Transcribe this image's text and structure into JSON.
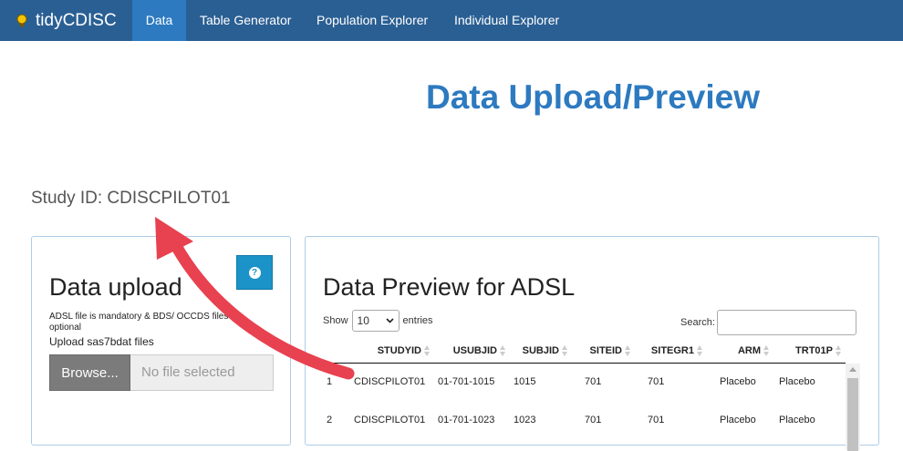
{
  "navbar": {
    "brand": "tidyCDISC",
    "tabs": [
      {
        "label": "Data",
        "active": true
      },
      {
        "label": "Table Generator",
        "active": false
      },
      {
        "label": "Population Explorer",
        "active": false
      },
      {
        "label": "Individual Explorer",
        "active": false
      }
    ]
  },
  "page": {
    "title": "Data Upload/Preview",
    "study_id": "Study ID: CDISCPILOT01"
  },
  "upload": {
    "heading": "Data upload",
    "help_icon": "question-circle-icon",
    "note": "ADSL file is mandatory & BDS/ OCCDS files are optional",
    "label": "Upload sas7bdat files",
    "browse_label": "Browse...",
    "file_placeholder": "No file selected"
  },
  "preview": {
    "heading": "Data Preview for ADSL",
    "show_label": "Show",
    "entries_value": "10",
    "entries_label": "entries",
    "search_label": "Search:",
    "columns": [
      "",
      "STUDYID",
      "USUBJID",
      "SUBJID",
      "SITEID",
      "SITEGR1",
      "ARM",
      "TRT01P"
    ],
    "rows": [
      [
        "1",
        "CDISCPILOT01",
        "01-701-1015",
        "1015",
        "701",
        "701",
        "Placebo",
        "Placebo"
      ],
      [
        "2",
        "CDISCPILOT01",
        "01-701-1023",
        "1023",
        "701",
        "701",
        "Placebo",
        "Placebo"
      ]
    ]
  },
  "colors": {
    "navbar": "#2a5f93",
    "accent": "#2d7ac0",
    "help_button": "#1b92c8",
    "annotation_arrow": "#e8414f"
  }
}
